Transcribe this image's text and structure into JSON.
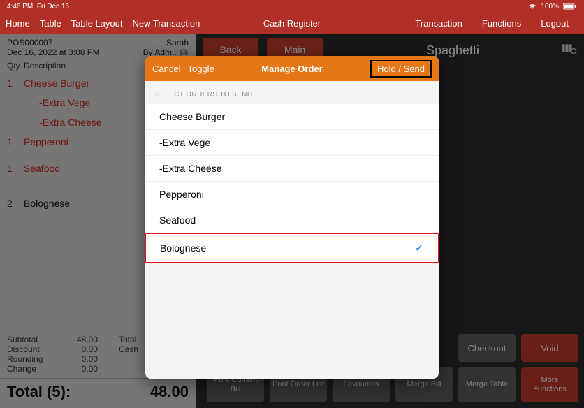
{
  "status": {
    "time": "4:46 PM",
    "date": "Fri Dec 16",
    "battery": "100%"
  },
  "topbar": {
    "home": "Home",
    "table": "Table",
    "table_layout": "Table Layout",
    "new_tx": "New Transaction",
    "center": "Cash Register",
    "transaction": "Transaction",
    "functions": "Functions",
    "logout": "Logout"
  },
  "receipt": {
    "pos_id": "POS000007",
    "cashier_name": "Sarah",
    "datetime": "Dec 16, 2022 at 3:08 PM",
    "by_prefix": "By",
    "by_value": "Adm..",
    "headers": {
      "qty": "Qty",
      "desc": "Description"
    },
    "lines": [
      {
        "qty": "1",
        "desc": "Cheese Burger",
        "state": "red"
      },
      {
        "qty": "",
        "desc": "-Extra Vege",
        "state": "red",
        "mod": true
      },
      {
        "qty": "",
        "desc": "-Extra Cheese",
        "state": "red",
        "mod": true
      },
      {
        "qty": "1",
        "desc": "Pepperoni",
        "state": "red"
      },
      {
        "qty": "1",
        "desc": "Seafood",
        "state": "red"
      },
      {
        "qty": "2",
        "desc": "Bolognese",
        "state": "black"
      }
    ],
    "totals": {
      "subtotal_lbl": "Subtotal",
      "subtotal_val": "48.00",
      "total_lbl": "Total",
      "discount_lbl": "Discount",
      "discount_val": "0.00",
      "cash_lbl": "Cash",
      "rounding_lbl": "Rounding",
      "rounding_val": "0.00",
      "change_lbl": "Change",
      "change_val": "0.00"
    },
    "grand_label": "Total (5):",
    "grand_value": "48.00"
  },
  "nav": {
    "back": "Back",
    "main": "Main",
    "title": "Spaghetti"
  },
  "bottom": {
    "print_bill": "Print Current Bill",
    "print_list": "Print Order List",
    "favourites": "Favourites",
    "merge_bill": "Merge Bill",
    "merge_table": "Merge Table",
    "more": "More Functions",
    "checkout": "Checkout",
    "void": "Void"
  },
  "modal": {
    "cancel": "Cancel",
    "toggle": "Toggle",
    "title": "Manage Order",
    "hold_send": "Hold / Send",
    "select_label": "SELECT ORDERS TO SEND",
    "items": [
      {
        "label": "Cheese Burger",
        "checked": false
      },
      {
        "label": "-Extra Vege",
        "checked": false,
        "mod": true
      },
      {
        "label": "-Extra Cheese",
        "checked": false,
        "mod": true
      },
      {
        "label": "Pepperoni",
        "checked": false
      },
      {
        "label": "Seafood",
        "checked": false
      },
      {
        "label": "Bolognese",
        "checked": true,
        "highlight": true
      }
    ]
  }
}
